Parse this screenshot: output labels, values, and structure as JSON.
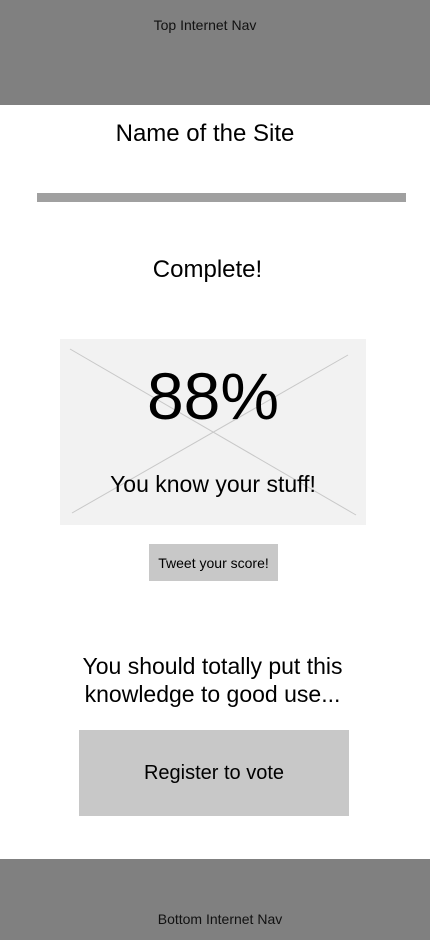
{
  "top_nav": {
    "label": "Top Internet Nav"
  },
  "header": {
    "site_name": "Name of the Site"
  },
  "quiz": {
    "progress": 1.0,
    "status": "Complete!",
    "score": "88%",
    "message": "You know your stuff!",
    "tweet_label": "Tweet your score!"
  },
  "cta": {
    "text": "You should totally put this\nknowledge to good use...",
    "register_label": "Register to vote"
  },
  "bottom_nav": {
    "label": "Bottom Internet Nav"
  },
  "colors": {
    "nav_bg": "#808080",
    "progress_fill": "#a0a0a0",
    "placeholder_bg": "#f2f2f2",
    "button_bg": "#c8c8c8"
  }
}
